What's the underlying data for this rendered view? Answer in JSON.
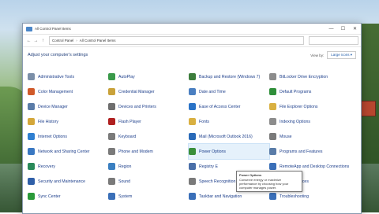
{
  "window": {
    "title": "All Control Panel Items",
    "controls": {
      "minimize": "—",
      "maximize": "☐",
      "close": "✕"
    }
  },
  "address": {
    "back": "←",
    "forward": "→",
    "up": "↑",
    "crumbs": [
      "Control Panel",
      "All Control Panel Items"
    ],
    "search_placeholder": ""
  },
  "header": {
    "title": "Adjust your computer's settings",
    "view_by_label": "View by:",
    "view_by_value": "Large icons ▾"
  },
  "items": [
    {
      "label": "Administrative Tools",
      "icon": "tools-icon",
      "color": "#7b8fa8"
    },
    {
      "label": "AutoPlay",
      "icon": "autoplay-icon",
      "color": "#3a9a4a"
    },
    {
      "label": "Backup and Restore (Windows 7)",
      "icon": "backup-icon",
      "color": "#3c7d3c"
    },
    {
      "label": "BitLocker Drive Encryption",
      "icon": "bitlocker-icon",
      "color": "#8c8c8c"
    },
    {
      "label": "Color Management",
      "icon": "color-icon",
      "color": "#d05a2a"
    },
    {
      "label": "Credential Manager",
      "icon": "credential-icon",
      "color": "#c9a23a"
    },
    {
      "label": "Date and Time",
      "icon": "clock-icon",
      "color": "#4a7fc1"
    },
    {
      "label": "Default Programs",
      "icon": "default-programs-icon",
      "color": "#2f8f3a"
    },
    {
      "label": "Device Manager",
      "icon": "device-manager-icon",
      "color": "#5a7ca8"
    },
    {
      "label": "Devices and Printers",
      "icon": "printer-icon",
      "color": "#6e6e6e"
    },
    {
      "label": "Ease of Access Center",
      "icon": "ease-access-icon",
      "color": "#2a73c7"
    },
    {
      "label": "File Explorer Options",
      "icon": "folder-options-icon",
      "color": "#d9b041"
    },
    {
      "label": "File History",
      "icon": "file-history-icon",
      "color": "#d4a73a"
    },
    {
      "label": "Flash Player",
      "icon": "flash-icon",
      "color": "#b02020"
    },
    {
      "label": "Fonts",
      "icon": "fonts-icon",
      "color": "#d9b041"
    },
    {
      "label": "Indexing Options",
      "icon": "indexing-icon",
      "color": "#8c8c8c"
    },
    {
      "label": "Internet Options",
      "icon": "internet-icon",
      "color": "#2f7fd1"
    },
    {
      "label": "Keyboard",
      "icon": "keyboard-icon",
      "color": "#7a7a7a"
    },
    {
      "label": "Mail (Microsoft Outlook 2016)",
      "icon": "mail-icon",
      "color": "#2a6ab8"
    },
    {
      "label": "Mouse",
      "icon": "mouse-icon",
      "color": "#7a7a7a"
    },
    {
      "label": "Network and Sharing Center",
      "icon": "network-icon",
      "color": "#3a78c2"
    },
    {
      "label": "Phone and Modem",
      "icon": "phone-icon",
      "color": "#7a7a7a"
    },
    {
      "label": "Power Options",
      "icon": "power-icon",
      "color": "#3a8f3a"
    },
    {
      "label": "Programs and Features",
      "icon": "programs-icon",
      "color": "#5a7ca8"
    },
    {
      "label": "Recovery",
      "icon": "recovery-icon",
      "color": "#2a8a5a"
    },
    {
      "label": "Region",
      "icon": "region-icon",
      "color": "#3a7fc1"
    },
    {
      "label": "Registry E",
      "icon": "registry-icon",
      "color": "#4a6fa8"
    },
    {
      "label": "RemoteApp and Desktop Connections",
      "icon": "remoteapp-icon",
      "color": "#3a6fb8"
    },
    {
      "label": "Security and Maintenance",
      "icon": "security-icon",
      "color": "#2f5fa8"
    },
    {
      "label": "Sound",
      "icon": "sound-icon",
      "color": "#7a7a7a"
    },
    {
      "label": "Speech Recognition",
      "icon": "speech-icon",
      "color": "#7a7a7a"
    },
    {
      "label": "Storage Spaces",
      "icon": "storage-icon",
      "color": "#6e6e6e"
    },
    {
      "label": "Sync Center",
      "icon": "sync-icon",
      "color": "#2a9a3a"
    },
    {
      "label": "System",
      "icon": "system-icon",
      "color": "#3a6fb8"
    },
    {
      "label": "Taskbar and Navigation",
      "icon": "taskbar-icon",
      "color": "#3a6fb8"
    },
    {
      "label": "Troubleshooting",
      "icon": "troubleshoot-icon",
      "color": "#3a6fb8"
    }
  ],
  "tooltip": {
    "title": "Power Options",
    "text": "Conserve energy or maximize performance by choosing how your computer manages power."
  }
}
